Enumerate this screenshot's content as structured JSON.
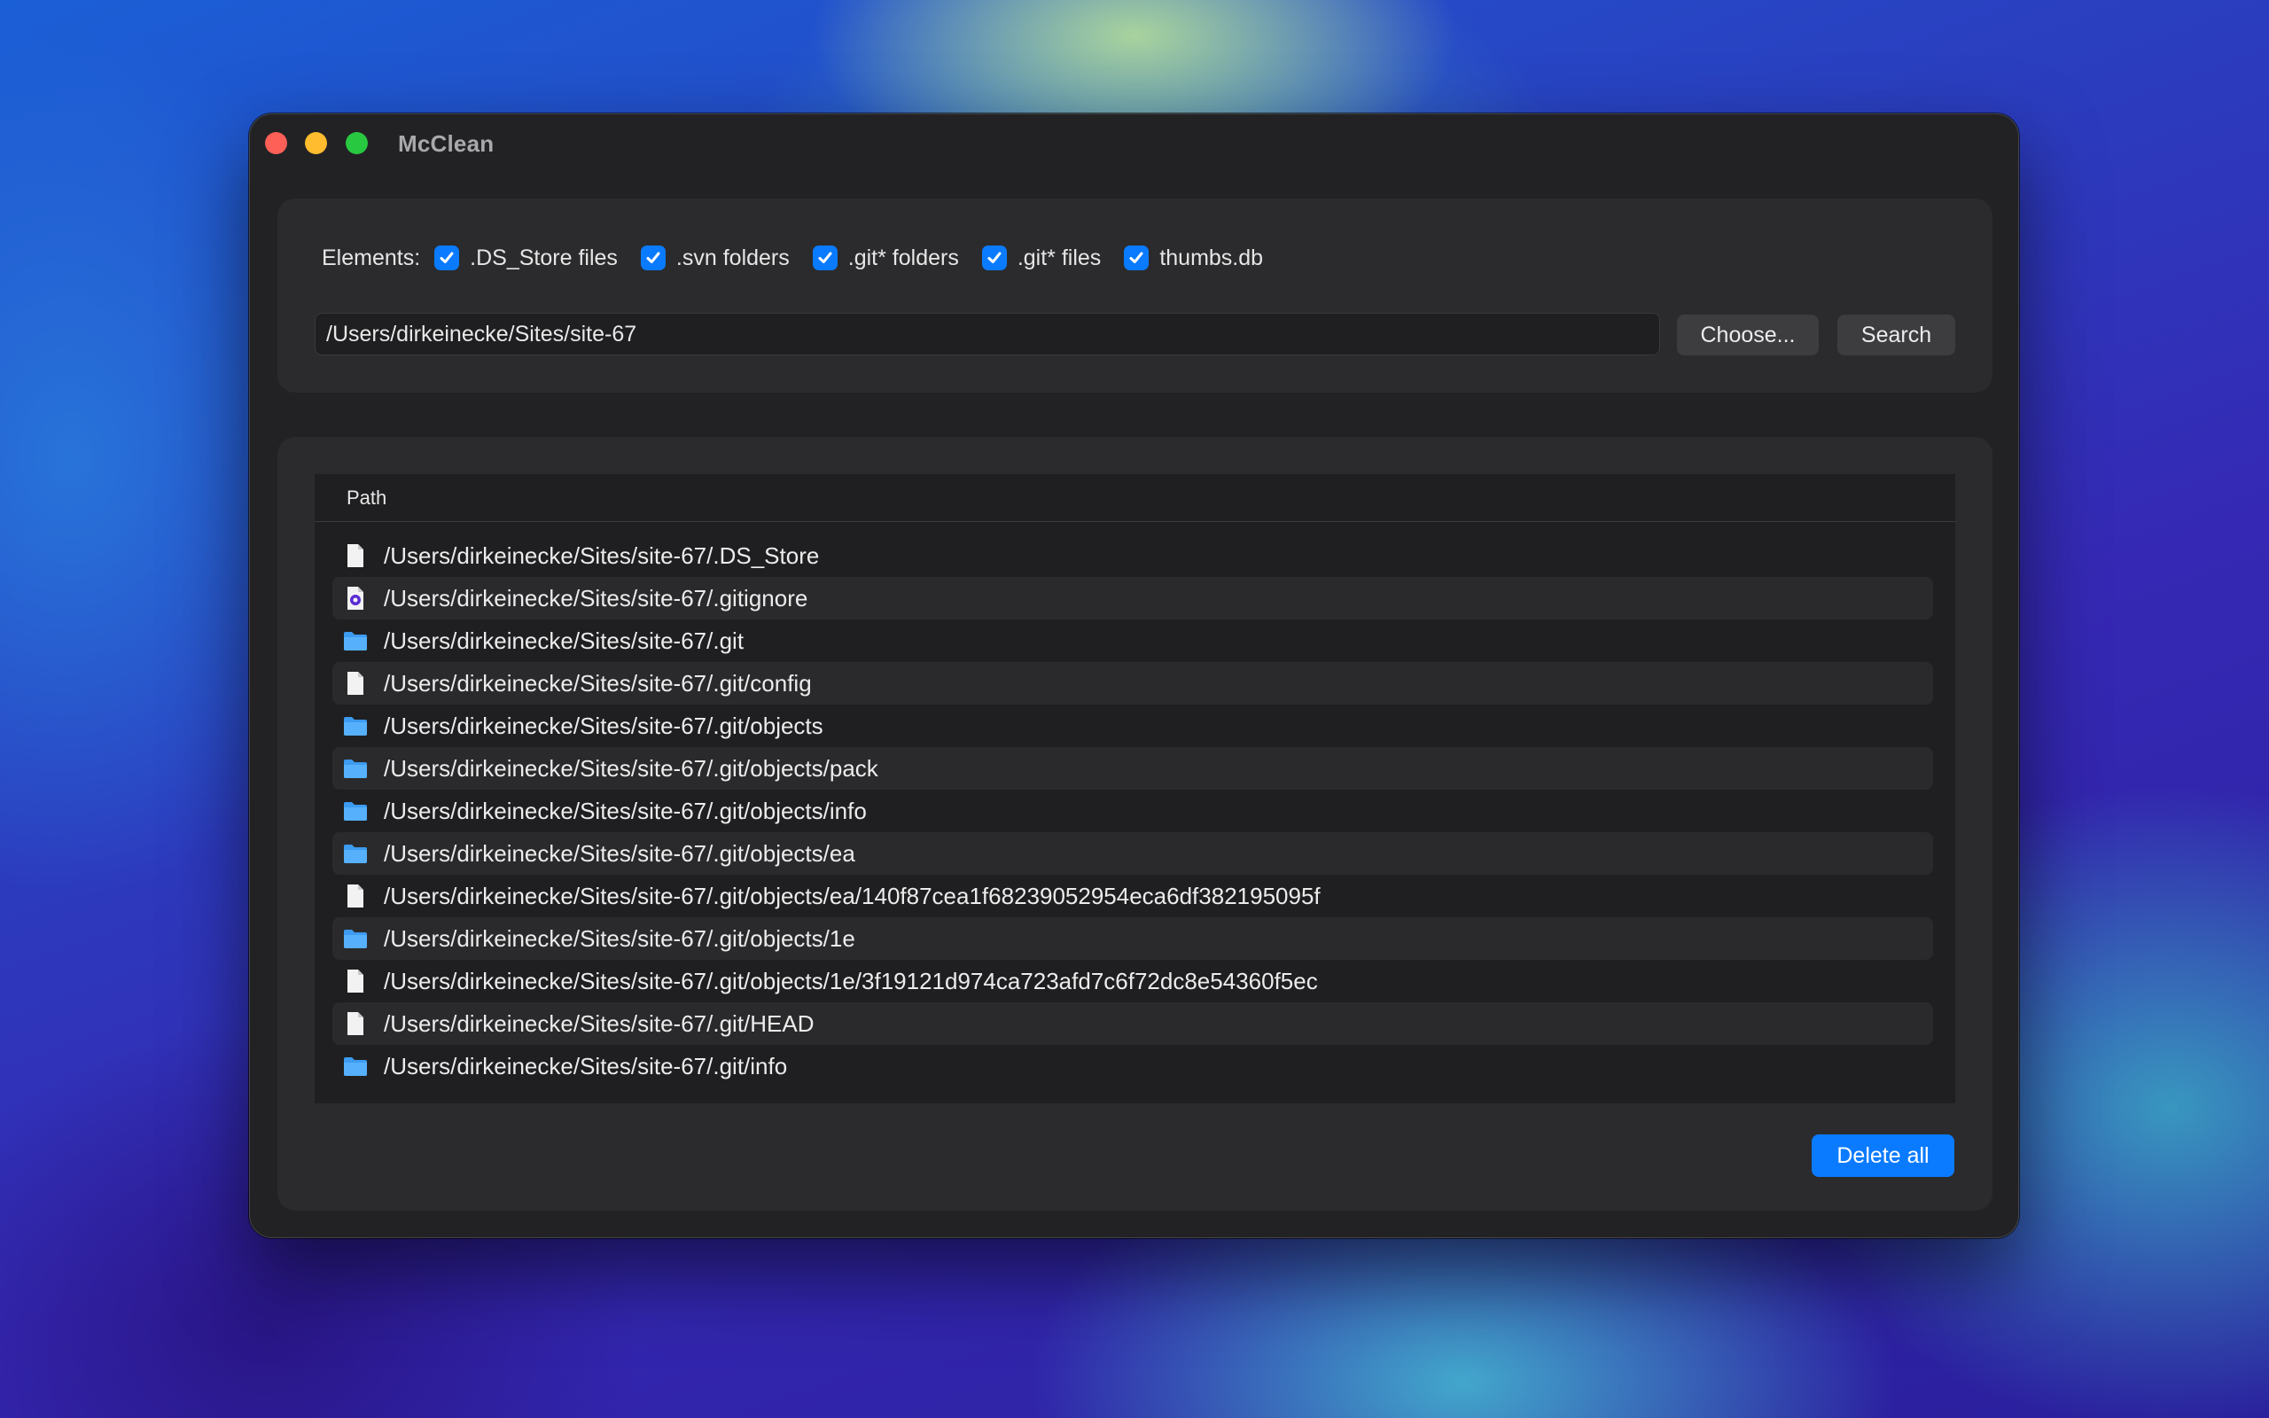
{
  "window": {
    "title": "McClean"
  },
  "options": {
    "label": "Elements:",
    "items": [
      {
        "label": ".DS_Store files",
        "checked": true
      },
      {
        "label": ".svn folders",
        "checked": true
      },
      {
        "label": ".git* folders",
        "checked": true
      },
      {
        "label": ".git* files",
        "checked": true
      },
      {
        "label": "thumbs.db",
        "checked": true
      }
    ]
  },
  "path_input": {
    "value": "/Users/dirkeinecke/Sites/site-67"
  },
  "buttons": {
    "choose": "Choose...",
    "search": "Search",
    "delete_all": "Delete all"
  },
  "table": {
    "header": "Path",
    "rows": [
      {
        "icon": "file-icon",
        "path": "/Users/dirkeinecke/Sites/site-67/.DS_Store"
      },
      {
        "icon": "gitignore-file-icon",
        "path": "/Users/dirkeinecke/Sites/site-67/.gitignore"
      },
      {
        "icon": "folder-icon",
        "path": "/Users/dirkeinecke/Sites/site-67/.git"
      },
      {
        "icon": "file-icon",
        "path": "/Users/dirkeinecke/Sites/site-67/.git/config"
      },
      {
        "icon": "folder-icon",
        "path": "/Users/dirkeinecke/Sites/site-67/.git/objects"
      },
      {
        "icon": "folder-icon",
        "path": "/Users/dirkeinecke/Sites/site-67/.git/objects/pack"
      },
      {
        "icon": "folder-icon",
        "path": "/Users/dirkeinecke/Sites/site-67/.git/objects/info"
      },
      {
        "icon": "folder-icon",
        "path": "/Users/dirkeinecke/Sites/site-67/.git/objects/ea"
      },
      {
        "icon": "file-icon",
        "path": "/Users/dirkeinecke/Sites/site-67/.git/objects/ea/140f87cea1f68239052954eca6df382195095f"
      },
      {
        "icon": "folder-icon",
        "path": "/Users/dirkeinecke/Sites/site-67/.git/objects/1e"
      },
      {
        "icon": "file-icon",
        "path": "/Users/dirkeinecke/Sites/site-67/.git/objects/1e/3f19121d974ca723afd7c6f72dc8e54360f5ec"
      },
      {
        "icon": "file-icon",
        "path": "/Users/dirkeinecke/Sites/site-67/.git/HEAD"
      },
      {
        "icon": "folder-icon",
        "path": "/Users/dirkeinecke/Sites/site-67/.git/info"
      }
    ]
  },
  "colors": {
    "accent": "#0a7bff",
    "window_bg": "#222224",
    "panel_bg": "#2b2b2d"
  }
}
